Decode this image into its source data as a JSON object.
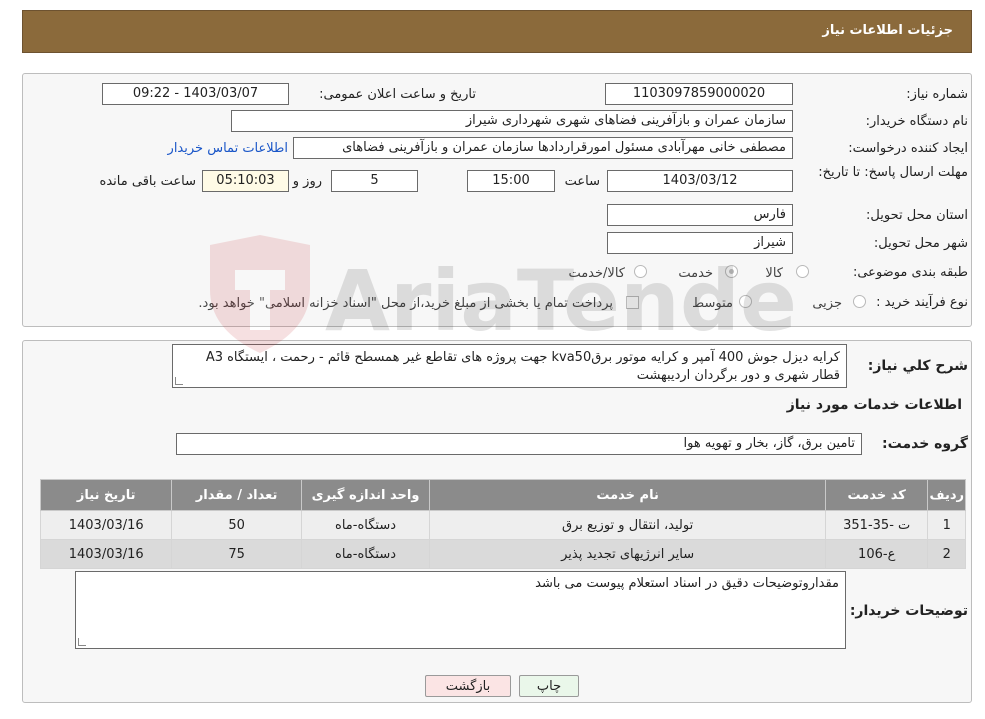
{
  "header": {
    "title": "جزئیات اطلاعات نیاز"
  },
  "form": {
    "need_number_label": "شماره نیاز:",
    "need_number": "1103097859000020",
    "announce_label": "تاریخ و ساعت اعلان عمومی:",
    "announce_value": "1403/03/07 - 09:22",
    "buyer_label": "نام دستگاه خریدار:",
    "buyer_value": "سازمان عمران و بازآفرینی فضاهای شهری شهرداری شیراز",
    "creator_label": "ایجاد کننده درخواست:",
    "creator_value": "مصطفی خانی مهرآبادی مسئول امورقراردادها سازمان عمران و بازآفرینی فضاهای",
    "contact_link": "اطلاعات تماس خریدار",
    "deadline_label": "مهلت ارسال پاسخ: تا تاریخ:",
    "deadline_date": "1403/03/12",
    "time_label": "ساعت",
    "deadline_time": "15:00",
    "days_value": "5",
    "days_label": "روز و",
    "remaining_value": "05:10:03",
    "remaining_label": "ساعت باقی مانده",
    "province_label": "استان محل تحویل:",
    "province_value": "فارس",
    "city_label": "شهر محل تحویل:",
    "city_value": "شیراز",
    "category_label": "طبقه بندی موضوعی:",
    "category_options": [
      "کالا",
      "خدمت",
      "کالا/خدمت"
    ],
    "category_selected": "خدمت",
    "process_label": "نوع فرآیند خرید :",
    "process_options": [
      "جزیی",
      "متوسط"
    ],
    "payment_note": "پرداخت تمام یا بخشی از مبلغ خرید،از محل \"اسناد خزانه اسلامی\" خواهد بود."
  },
  "description": {
    "label": "شرح کلي نياز:",
    "text": "کرایه دیزل جوش 400 آمپر و کرایه موتور برقkva50 جهت پروژه های تقاطع غیر همسطح قائم - رحمت ، ایستگاه A3 قطار شهری و دور برگردان اردیبهشت"
  },
  "services": {
    "section_title": "اطلاعات خدمات مورد نیاز",
    "group_label": "گروه خدمت:",
    "group_value": "تامین برق، گاز، بخار و تهویه هوا",
    "columns": [
      "ردیف",
      "کد خدمت",
      "نام خدمت",
      "واحد اندازه گیری",
      "تعداد / مقدار",
      "تاریخ نیاز"
    ],
    "rows": [
      {
        "row": "1",
        "code": "ت -35-351",
        "name": "تولید، انتقال و توزیع برق",
        "unit": "دستگاه-ماه",
        "qty": "50",
        "date": "1403/03/16"
      },
      {
        "row": "2",
        "code": "ع-106",
        "name": "سایر انرژیهای تجدید پذیر",
        "unit": "دستگاه-ماه",
        "qty": "75",
        "date": "1403/03/16"
      }
    ]
  },
  "buyer_notes": {
    "label": "توضیحات خریدار:",
    "text": "مقداروتوضیحات دقیق در اسناد استعلام پیوست می باشد"
  },
  "buttons": {
    "print": "چاپ",
    "back": "بازگشت"
  },
  "watermark": {
    "text": "AriaTender.neT"
  }
}
